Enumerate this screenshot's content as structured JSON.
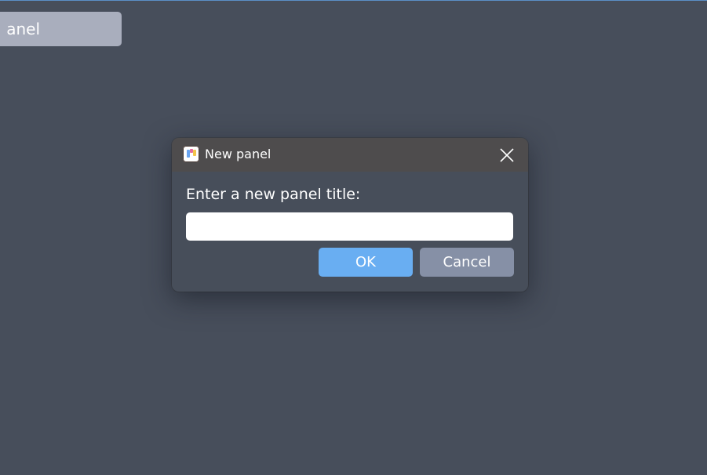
{
  "background": {
    "panel_button_label": "anel"
  },
  "dialog": {
    "title": "New panel",
    "app_icon": "app-logo-icon",
    "close_icon": "close-icon",
    "prompt": "Enter a new panel title:",
    "input": {
      "value": "",
      "placeholder": ""
    },
    "ok_label": "OK",
    "cancel_label": "Cancel"
  },
  "colors": {
    "desktop_background": "#474e5b",
    "titlebar": "#4e4c4d",
    "ok_button": "#69aef2",
    "cancel_button": "#8690a6",
    "panel_button": "#a9aebd",
    "accent_line": "#5b8fc7"
  }
}
